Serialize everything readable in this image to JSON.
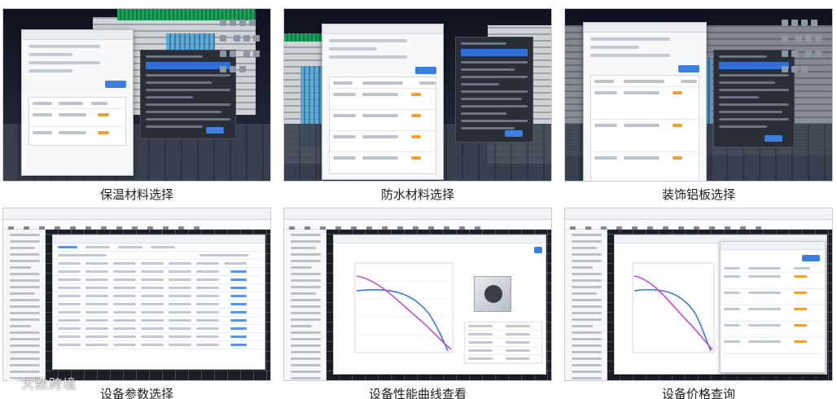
{
  "panels": [
    {
      "caption": "保温材料选择"
    },
    {
      "caption": "防水材料选择"
    },
    {
      "caption": "装饰铝板选择"
    },
    {
      "caption": "设备参数选择"
    },
    {
      "caption": "设备性能曲线查看"
    },
    {
      "caption": "设备价格查询"
    }
  ],
  "watermark": {
    "text": "大数跨境"
  },
  "colors": {
    "accent": "#3c7fe0",
    "cad_background": "#1b1f27",
    "curve_blue": "#3a78d8",
    "curve_magenta": "#c24fc8",
    "highlight": "#f0a030"
  }
}
